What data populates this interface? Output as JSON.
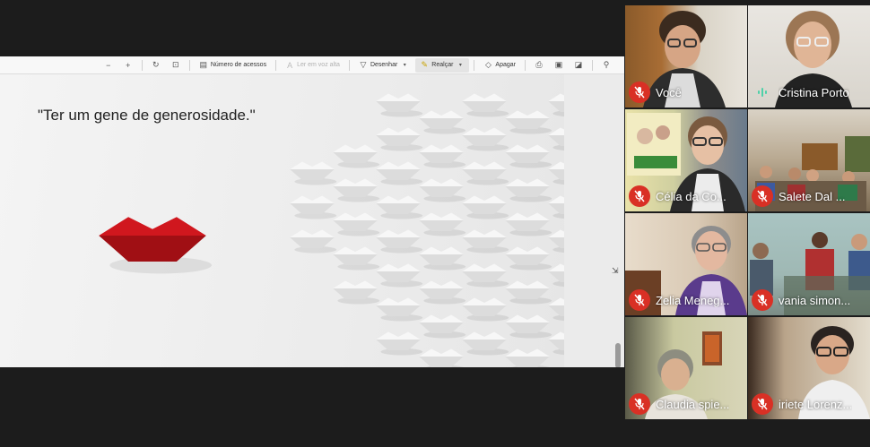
{
  "toolbar": {
    "items": [
      {
        "label": "Número de acessos",
        "icon": "page-view-icon",
        "disabled": false
      },
      {
        "label": "Ler em voz alta",
        "icon": "read-aloud-icon",
        "disabled": true
      },
      {
        "label": "Desenhar",
        "icon": "draw-icon",
        "disabled": false
      },
      {
        "label": "Realçar",
        "icon": "highlight-icon",
        "disabled": false,
        "active": true
      },
      {
        "label": "Apagar",
        "icon": "eraser-icon",
        "disabled": false
      }
    ]
  },
  "slide": {
    "quote": "\"Ter um gene de generosidade.\"",
    "accent_color": "#d0171e"
  },
  "participants": [
    {
      "name": "Você",
      "mic": "muted"
    },
    {
      "name": "Cristina Porto",
      "mic": "speaking"
    },
    {
      "name": "Célia da Co...",
      "mic": "muted"
    },
    {
      "name": "Salete Dal ...",
      "mic": "muted"
    },
    {
      "name": "Zelia Meneg...",
      "mic": "muted"
    },
    {
      "name": "vania simon...",
      "mic": "muted"
    },
    {
      "name": "Claudia spie...",
      "mic": "muted"
    },
    {
      "name": "iriete Lorenz...",
      "mic": "muted"
    }
  ]
}
